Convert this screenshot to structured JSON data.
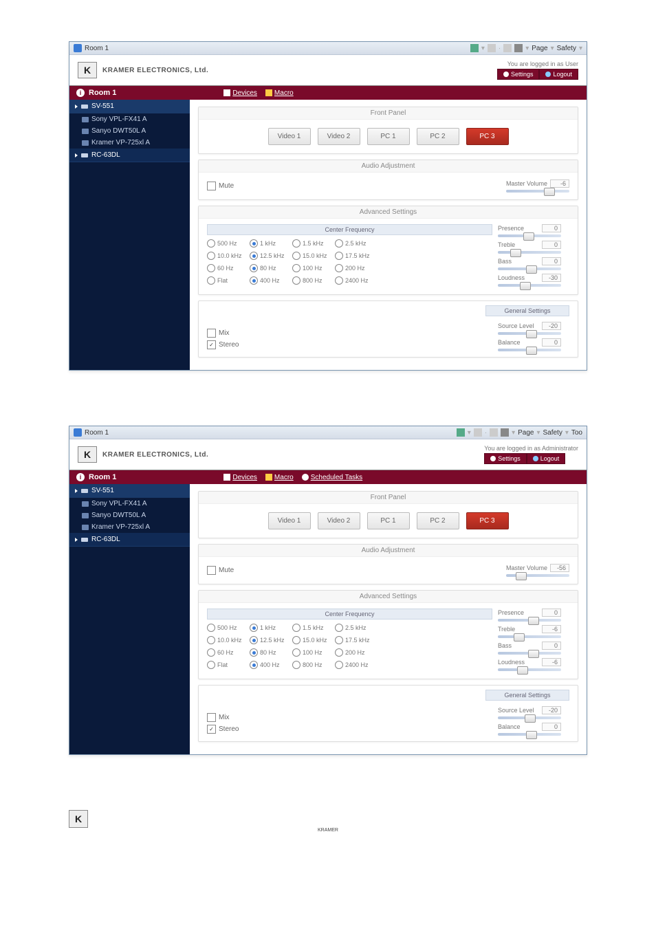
{
  "window": {
    "title": "Room 1",
    "toolbar": {
      "page": "Page",
      "safety": "Safety"
    }
  },
  "brand": {
    "company": "KRAMER ELECTRONICS, Ltd.",
    "login_user": "You are logged in as User",
    "login_admin": "You are logged in as Administrator",
    "settings": "Settings",
    "logout": "Logout"
  },
  "room": {
    "name": "Room 1",
    "tabs": {
      "devices": "Devices",
      "macro": "Macro",
      "scheduled": "Scheduled Tasks"
    }
  },
  "sidebar": {
    "head1": "SV-551",
    "items": [
      "Sony VPL-FX41 A",
      "Sanyo DWT50L A",
      "Kramer VP-725xl A"
    ],
    "head2": "RC-63DL"
  },
  "frontpanel": {
    "title": "Front Panel",
    "buttons": [
      "Video 1",
      "Video 2",
      "PC 1",
      "PC 2",
      "PC 3"
    ],
    "active_index": 4
  },
  "audio": {
    "title": "Audio Adjustment",
    "mute": "Mute",
    "master_label": "Master Volume",
    "master_value_user": "-6",
    "master_value_admin": "-56"
  },
  "advanced": {
    "title": "Advanced Settings",
    "center_freq": "Center Frequency",
    "rows": [
      [
        "500 Hz",
        "1 kHz",
        "1.5 kHz",
        "2.5 kHz"
      ],
      [
        "10.0 kHz",
        "12.5 kHz",
        "15.0 kHz",
        "17.5 kHz"
      ],
      [
        "60 Hz",
        "80 Hz",
        "100 Hz",
        "200 Hz"
      ],
      [
        "Flat",
        "400 Hz",
        "800 Hz",
        "2400 Hz"
      ]
    ],
    "selected_col": 1,
    "sliders": [
      {
        "label": "Presence",
        "value": "0"
      },
      {
        "label": "Treble",
        "value": "0"
      },
      {
        "label": "Bass",
        "value": "0"
      },
      {
        "label": "Loudness",
        "value": "-30"
      }
    ],
    "sliders_admin": [
      {
        "label": "Presence",
        "value": "0"
      },
      {
        "label": "Treble",
        "value": "-6"
      },
      {
        "label": "Bass",
        "value": "0"
      },
      {
        "label": "Loudness",
        "value": "-6"
      }
    ]
  },
  "general": {
    "title": "General Settings",
    "mix": "Mix",
    "stereo": "Stereo",
    "sliders": [
      {
        "label": "Source Level",
        "value": "-20"
      },
      {
        "label": "Balance",
        "value": "0"
      }
    ]
  },
  "footer": {
    "caption": "KRAMER"
  }
}
